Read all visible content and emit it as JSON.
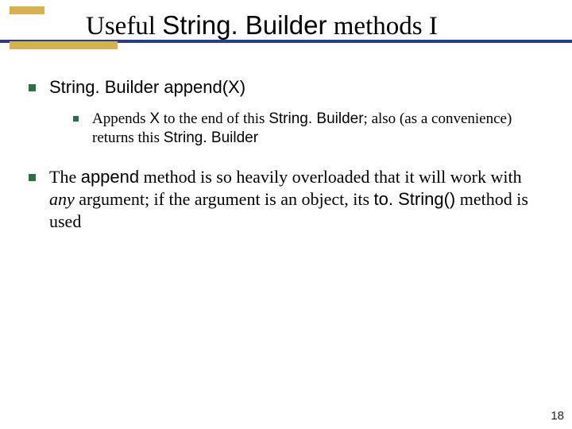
{
  "title": {
    "t1": "Useful ",
    "t2": "String. Builder",
    "t3": " methods I"
  },
  "bullet1": {
    "b1": "String. Builder append(X)"
  },
  "bullet1_sub": {
    "s1": "Appends ",
    "s2": "X",
    "s3": " to the end of this ",
    "s4": "String. Builder",
    "s5": "; also (as a convenience)  returns this ",
    "s6": "String. Builder"
  },
  "bullet2": {
    "p1": "The ",
    "p2": "append",
    "p3": " method is so heavily overloaded that it will work with ",
    "p4": "any",
    "p5": " argument; if the argument is an object, its ",
    "p6": "to. String()",
    "p7": " method is used"
  },
  "page_number": "18"
}
